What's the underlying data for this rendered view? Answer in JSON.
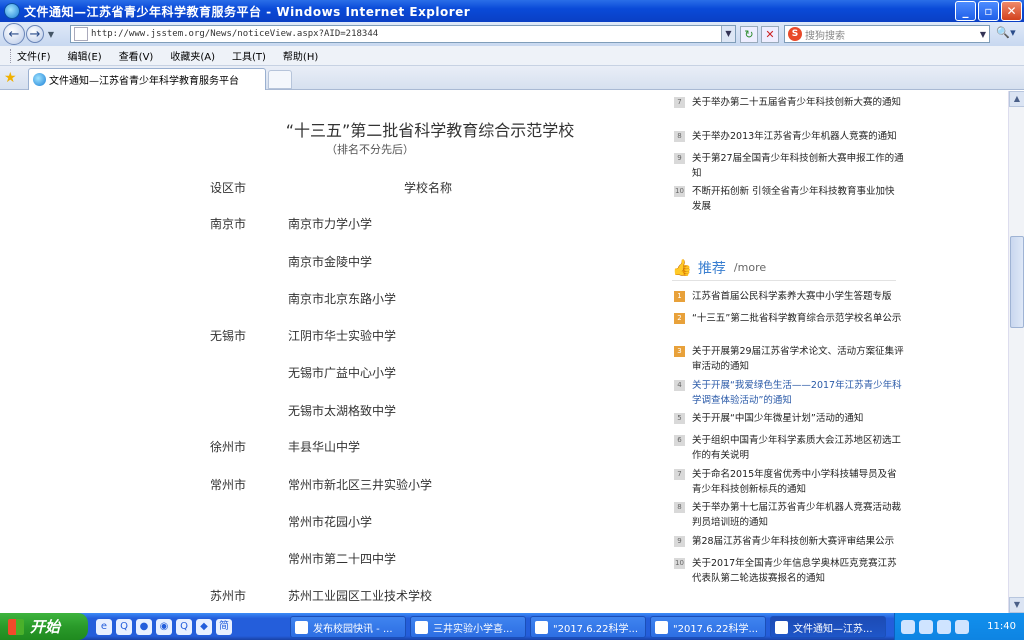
{
  "window": {
    "title": "文件通知—江苏省青少年科学教育服务平台 - Windows Internet Explorer"
  },
  "address": {
    "url": "http://www.jsstem.org/News/noticeView.aspx?AID=218344",
    "search_placeholder": "搜狗搜索"
  },
  "menu": [
    "文件(F)",
    "编辑(E)",
    "查看(V)",
    "收藏夹(A)",
    "工具(T)",
    "帮助(H)"
  ],
  "tab": {
    "label": "文件通知—江苏省青少年科学教育服务平台"
  },
  "notice": {
    "title": "“十三五”第二批省科学教育综合示范学校",
    "subtitle": "（排名不分先后）",
    "col_city": "设区市",
    "col_school": "学校名称",
    "rows": [
      {
        "city": "南京市",
        "school": "南京市力学小学"
      },
      {
        "city": "",
        "school": "南京市金陵中学"
      },
      {
        "city": "",
        "school": "南京市北京东路小学"
      },
      {
        "city": "无锡市",
        "school": "江阴市华士实验中学"
      },
      {
        "city": "",
        "school": "无锡市广益中心小学"
      },
      {
        "city": "",
        "school": "无锡市太湖格致中学"
      },
      {
        "city": "徐州市",
        "school": "丰县华山中学"
      },
      {
        "city": "常州市",
        "school": "常州市新北区三井实验小学"
      },
      {
        "city": "",
        "school": "常州市花园小学"
      },
      {
        "city": "",
        "school": "常州市第二十四中学"
      },
      {
        "city": "苏州市",
        "school": "苏州工业园区工业技术学校"
      }
    ]
  },
  "top_list": [
    {
      "num": "7",
      "text": "关于举办第二十五届省青少年科技创新大赛的通知"
    },
    {
      "num": "8",
      "text": "关于举办2013年江苏省青少年机器人竞赛的通知"
    },
    {
      "num": "9",
      "text": "关于第27届全国青少年科技创新大赛申报工作的通知"
    },
    {
      "num": "10",
      "text": "不断开拓创新 引领全省青少年科技教育事业加快发展"
    }
  ],
  "recommend": {
    "title": "推荐",
    "more": "/more",
    "items": [
      {
        "num": "1",
        "text": "江苏省首届公民科学素养大赛中小学生答题专版"
      },
      {
        "num": "2",
        "text": "“十三五”第二批省科学教育综合示范学校名单公示"
      },
      {
        "num": "3",
        "text": "关于开展第29届江苏省学术论文、活动方案征集评审活动的通知"
      },
      {
        "num": "4",
        "text": "关于开展“我爱绿色生活——2017年江苏青少年科学调查体验活动”的通知"
      },
      {
        "num": "5",
        "text": "关于开展“中国少年微星计划”活动的通知"
      },
      {
        "num": "6",
        "text": "关于组织中国青少年科学素质大会江苏地区初选工作的有关说明"
      },
      {
        "num": "7",
        "text": "关于命名2015年度省优秀中小学科技辅导员及省青少年科技创新标兵的通知"
      },
      {
        "num": "8",
        "text": "关于举办第十七届江苏省青少年机器人竞赛活动裁判员培训班的通知"
      },
      {
        "num": "9",
        "text": "第28届江苏省青少年科技创新大赛评审结果公示"
      },
      {
        "num": "10",
        "text": "关于2017年全国青少年信息学奥林匹克竞赛江苏代表队第二轮选拔赛报名的通知"
      }
    ]
  },
  "taskbar": {
    "start": "开始",
    "tasks": [
      "发布校园快讯 - ...",
      "三井实验小学喜...",
      "\"2017.6.22科学...",
      "\"2017.6.22科学...",
      "文件通知—江苏..."
    ],
    "clock": "11:40"
  }
}
